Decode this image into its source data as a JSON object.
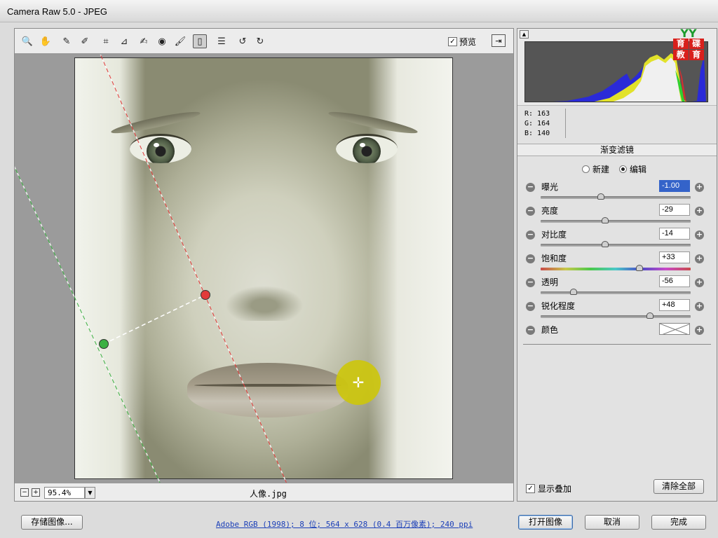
{
  "window": {
    "title": "Camera Raw 5.0 -  JPEG"
  },
  "toolbar": {
    "tools": [
      {
        "name": "zoom-tool",
        "icon": "magnifier-icon",
        "glyph": "🔍"
      },
      {
        "name": "hand-tool",
        "icon": "hand-icon",
        "glyph": "✋"
      },
      {
        "name": "white-balance-tool",
        "icon": "eyedropper-icon",
        "glyph": "✎"
      },
      {
        "name": "color-sampler-tool",
        "icon": "sampler-icon",
        "glyph": "✐"
      },
      {
        "name": "crop-tool",
        "icon": "crop-icon",
        "glyph": "⌗"
      },
      {
        "name": "straighten-tool",
        "icon": "straighten-icon",
        "glyph": "⊿"
      },
      {
        "name": "spot-removal-tool",
        "icon": "brush-spot-icon",
        "glyph": "✍"
      },
      {
        "name": "red-eye-tool",
        "icon": "eye-icon",
        "glyph": "◉"
      },
      {
        "name": "adjustment-brush-tool",
        "icon": "brush-icon",
        "glyph": "🖌"
      },
      {
        "name": "graduated-filter-tool",
        "icon": "graduated-filter-icon",
        "glyph": "▯"
      },
      {
        "name": "preferences-tool",
        "icon": "list-icon",
        "glyph": "☰"
      },
      {
        "name": "rotate-left-tool",
        "icon": "rotate-ccw-icon",
        "glyph": "↺"
      },
      {
        "name": "rotate-right-tool",
        "icon": "rotate-cw-icon",
        "glyph": "↻"
      }
    ],
    "preview_label": "预览",
    "preview_checked": "✓"
  },
  "status": {
    "zoom_minus": "−",
    "zoom_plus": "+",
    "zoom_value": "95.4%",
    "zoom_dropdown": "▼",
    "filename": "人像.jpg"
  },
  "histogram": {
    "collapse_glyph": "▲",
    "logo": {
      "top": "YY",
      "chars": [
        "育",
        "碟",
        "教",
        "育"
      ]
    },
    "r": "R:  163",
    "g": "G:  164",
    "b": "B:  140"
  },
  "panel": {
    "title": "渐变滤镜",
    "mode_new": "新建",
    "mode_edit": "编辑",
    "adjustments": [
      {
        "name": "exposure",
        "label": "曝光",
        "value": "-1.00",
        "level": 0.4,
        "selected": true
      },
      {
        "name": "brightness",
        "label": "亮度",
        "value": "-29",
        "level": 0.43
      },
      {
        "name": "contrast",
        "label": "对比度",
        "value": "-14",
        "level": 0.43
      },
      {
        "name": "saturation",
        "label": "饱和度",
        "value": "+33",
        "level": 0.66,
        "rainbow": true
      },
      {
        "name": "clarity",
        "label": "透明",
        "value": "-56",
        "level": 0.22
      },
      {
        "name": "sharpness",
        "label": "锐化程度",
        "value": "+48",
        "level": 0.73
      }
    ],
    "color_label": "颜色",
    "minus_glyph": "−",
    "plus_glyph": "+",
    "show_overlay_label": "显示叠加",
    "show_overlay_checked": "✓",
    "clear_all_label": "清除全部"
  },
  "footer": {
    "save_label": "存储图像...",
    "info_link": "Adobe RGB (1998); 8 位; 564 x 628 (0.4 百万像素); 240 ppi",
    "open_label": "打开图像",
    "cancel_label": "取消",
    "done_label": "完成"
  },
  "colors": {
    "accent_selected": "#3463c9",
    "pin_yellow": "#cdc60a",
    "dot_red": "#e23a3a",
    "dot_green": "#3cb043"
  }
}
